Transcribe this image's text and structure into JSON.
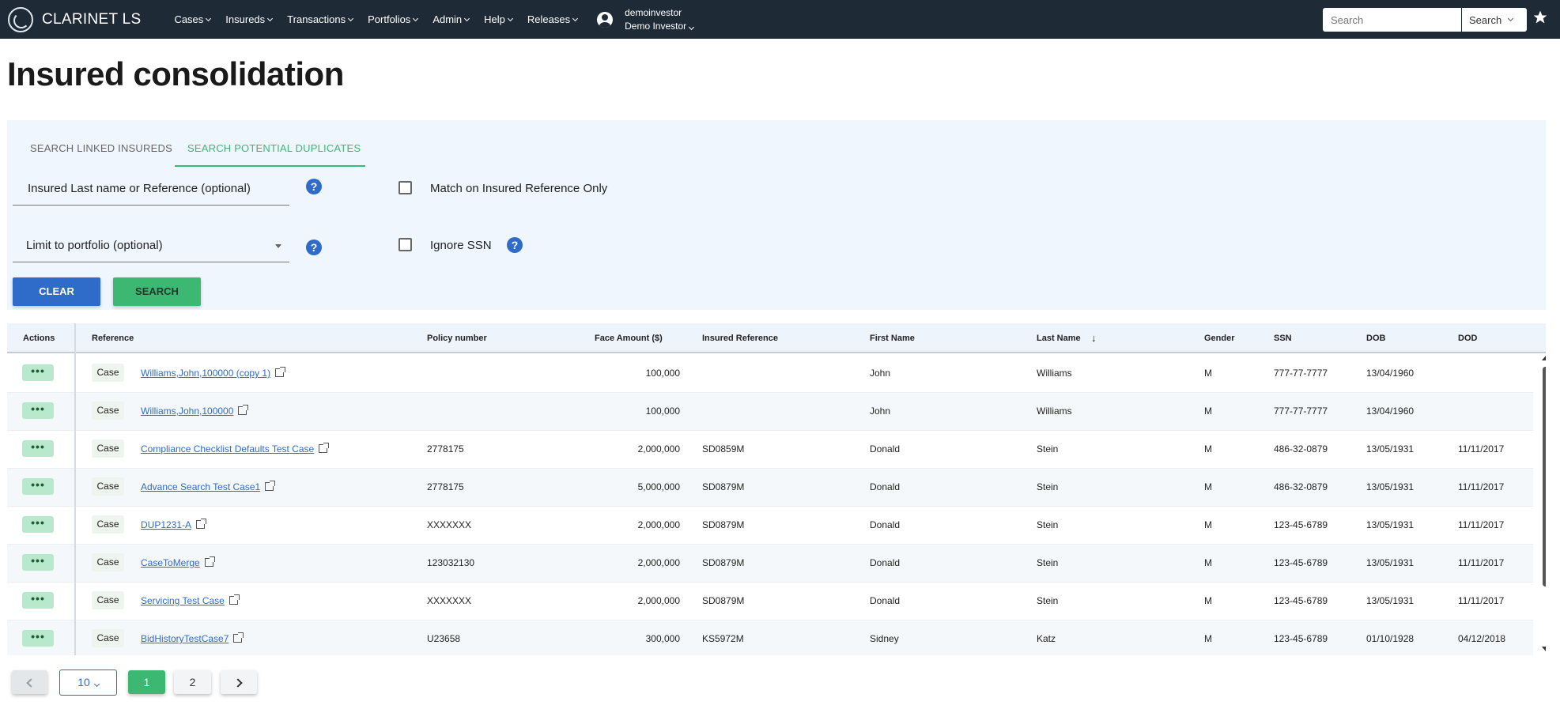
{
  "app": {
    "brand": "CLARINET LS"
  },
  "nav": [
    {
      "id": "cases",
      "label": "Cases"
    },
    {
      "id": "insureds",
      "label": "Insureds"
    },
    {
      "id": "transactions",
      "label": "Transactions"
    },
    {
      "id": "portfolios",
      "label": "Portfolios"
    },
    {
      "id": "admin",
      "label": "Admin"
    },
    {
      "id": "help",
      "label": "Help"
    },
    {
      "id": "releases",
      "label": "Releases"
    }
  ],
  "user": {
    "username": "demoinvestor",
    "display_name": "Demo Investor"
  },
  "global_search": {
    "placeholder": "Search",
    "button_label": "Search"
  },
  "page": {
    "title": "Insured consolidation"
  },
  "tabs": [
    {
      "label": "SEARCH LINKED INSUREDS",
      "active": false
    },
    {
      "label": "SEARCH POTENTIAL DUPLICATES",
      "active": true
    }
  ],
  "form": {
    "last_name_placeholder": "Insured Last name or Reference (optional)",
    "portfolio_placeholder": "Limit to portfolio (optional)",
    "match_reference_label": "Match on Insured Reference Only",
    "ignore_ssn_label": "Ignore SSN",
    "help_glyph": "?",
    "clear_label": "CLEAR",
    "search_label": "SEARCH"
  },
  "table": {
    "columns": {
      "actions": "Actions",
      "reference": "Reference",
      "policy_number": "Policy number",
      "face_amount": "Face Amount ($)",
      "insured_reference": "Insured Reference",
      "first_name": "First Name",
      "last_name": "Last Name",
      "gender": "Gender",
      "ssn": "SSN",
      "dob": "DOB",
      "dod": "DOD"
    },
    "sort_glyph": "↓",
    "actions_glyph": "•••",
    "rows": [
      {
        "type": "Case",
        "reference": "Williams,John,100000 (copy 1)",
        "policy_number": "",
        "face_amount": "100,000",
        "insured_reference": "",
        "first_name": "John",
        "last_name": "Williams",
        "gender": "M",
        "ssn": "777-77-7777",
        "dob": "13/04/1960",
        "dod": ""
      },
      {
        "type": "Case",
        "reference": "Williams,John,100000",
        "policy_number": "",
        "face_amount": "100,000",
        "insured_reference": "",
        "first_name": "John",
        "last_name": "Williams",
        "gender": "M",
        "ssn": "777-77-7777",
        "dob": "13/04/1960",
        "dod": ""
      },
      {
        "type": "Case",
        "reference": "Compliance Checklist Defaults Test Case",
        "policy_number": "2778175",
        "face_amount": "2,000,000",
        "insured_reference": "SD0859M",
        "first_name": "Donald",
        "last_name": "Stein",
        "gender": "M",
        "ssn": "486-32-0879",
        "dob": "13/05/1931",
        "dod": "11/11/2017"
      },
      {
        "type": "Case",
        "reference": "Advance Search Test Case1",
        "policy_number": "2778175",
        "face_amount": "5,000,000",
        "insured_reference": "SD0879M",
        "first_name": "Donald",
        "last_name": "Stein",
        "gender": "M",
        "ssn": "486-32-0879",
        "dob": "13/05/1931",
        "dod": "11/11/2017"
      },
      {
        "type": "Case",
        "reference": "DUP1231-A",
        "policy_number": "XXXXXXX",
        "face_amount": "2,000,000",
        "insured_reference": "SD0879M",
        "first_name": "Donald",
        "last_name": "Stein",
        "gender": "M",
        "ssn": "123-45-6789",
        "dob": "13/05/1931",
        "dod": "11/11/2017"
      },
      {
        "type": "Case",
        "reference": "CaseToMerge",
        "policy_number": "123032130",
        "face_amount": "2,000,000",
        "insured_reference": "SD0879M",
        "first_name": "Donald",
        "last_name": "Stein",
        "gender": "M",
        "ssn": "123-45-6789",
        "dob": "13/05/1931",
        "dod": "11/11/2017"
      },
      {
        "type": "Case",
        "reference": "Servicing Test Case",
        "policy_number": "XXXXXXX",
        "face_amount": "2,000,000",
        "insured_reference": "SD0879M",
        "first_name": "Donald",
        "last_name": "Stein",
        "gender": "M",
        "ssn": "123-45-6789",
        "dob": "13/05/1931",
        "dod": "11/11/2017"
      },
      {
        "type": "Case",
        "reference": "BidHistoryTestCase7",
        "policy_number": "U23658",
        "face_amount": "300,000",
        "insured_reference": "KS5972M",
        "first_name": "Sidney",
        "last_name": "Katz",
        "gender": "M",
        "ssn": "123-45-6789",
        "dob": "01/10/1928",
        "dod": "04/12/2018"
      }
    ]
  },
  "pagination": {
    "page_size": "10",
    "pages": [
      "1",
      "2"
    ],
    "current_page": "1"
  },
  "icons": {
    "logo": "clarinet-logo-icon",
    "user": "user-circle-icon",
    "star": "star-icon",
    "help": "help-circle-icon",
    "external_link": "external-link-icon",
    "sort_desc": "arrow-down-icon"
  },
  "colors": {
    "navbar": "#1e2a36",
    "primary": "#2f6bc8",
    "accent_green": "#3db873",
    "panel_bg": "#eff6fd"
  }
}
